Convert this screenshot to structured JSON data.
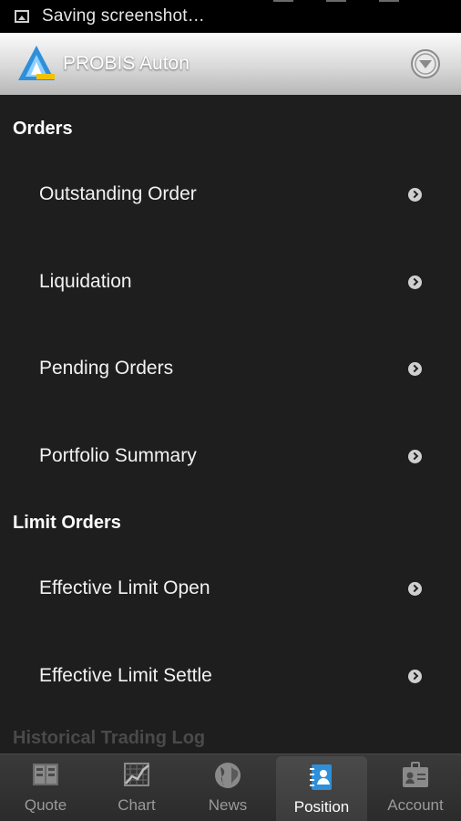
{
  "status_bar": {
    "notification_text": "Saving screenshot…"
  },
  "header": {
    "title": "PROBIS Auton"
  },
  "sections": [
    {
      "title": "Orders"
    },
    {
      "title": "Limit Orders"
    },
    {
      "title": "Historical Trading Log"
    }
  ],
  "menu": {
    "outstanding_order": "Outstanding Order",
    "liquidation": "Liquidation",
    "pending_orders": "Pending Orders",
    "portfolio_summary": "Portfolio Summary",
    "effective_limit_open": "Effective Limit Open",
    "effective_limit_settle": "Effective Limit Settle"
  },
  "bottom_nav": {
    "tabs": [
      {
        "label": "Quote",
        "icon": "quote-icon"
      },
      {
        "label": "Chart",
        "icon": "chart-icon"
      },
      {
        "label": "News",
        "icon": "globe-icon"
      },
      {
        "label": "Position",
        "icon": "position-icon",
        "active": true
      },
      {
        "label": "Account",
        "icon": "account-icon"
      }
    ]
  },
  "colors": {
    "background": "#1e1e1e",
    "header_bg": "#d9d9d9",
    "accent_blue": "#2f8fd8"
  }
}
